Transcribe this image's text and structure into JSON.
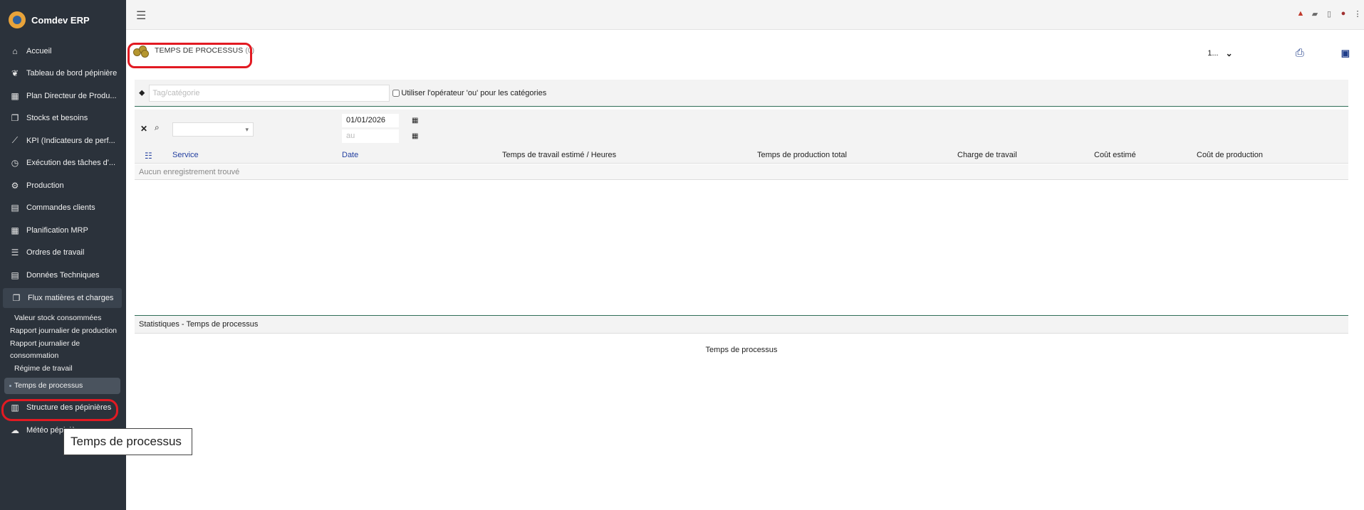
{
  "sidebar": {
    "brand": "Comdev ERP",
    "items": [
      {
        "label": "Accueil",
        "icon": "home-icon"
      },
      {
        "label": "Tableau de bord pépinière",
        "icon": "leaf-icon"
      },
      {
        "label": "Plan Directeur de Produ...",
        "icon": "calendar-icon"
      },
      {
        "label": "Stocks et besoins",
        "icon": "boxes-icon"
      },
      {
        "label": "KPI (Indicateurs de perf...",
        "icon": "chart-line-icon"
      },
      {
        "label": "Exécution des tâches d'...",
        "icon": "clock-icon"
      },
      {
        "label": "Production",
        "icon": "cogs-icon"
      },
      {
        "label": "Commandes clients",
        "icon": "file-icon"
      },
      {
        "label": "Planification MRP",
        "icon": "calendar-icon"
      },
      {
        "label": "Ordres de travail",
        "icon": "tasks-icon"
      },
      {
        "label": "Données Techniques",
        "icon": "file-icon"
      },
      {
        "label": "Flux matières et charges",
        "icon": "boxes-icon"
      }
    ],
    "subitems": [
      "Valeur stock consommées",
      "Rapport journalier de production",
      "Rapport journalier de consommation",
      "Régime de travail",
      "Temps de processus"
    ],
    "after_items": [
      {
        "label": "Structure des pépinières",
        "icon": "grid-icon"
      },
      {
        "label": "Météo pépinière",
        "icon": "weather-icon"
      }
    ]
  },
  "page": {
    "title": "TEMPS DE PROCESSUS",
    "count": "(0)",
    "page_size": "1..."
  },
  "filters": {
    "tag_placeholder": "Tag/catégorie",
    "or_label": "Utiliser l'opérateur 'ou' pour les catégories",
    "date_from": "01/01/2026",
    "date_to_placeholder": "au",
    "service_caret": "▾"
  },
  "table": {
    "columns": [
      "Service",
      "Date",
      "Temps de travail estimé / Heures",
      "Temps de production total",
      "Charge de travail",
      "Coût estimé",
      "Coût de production"
    ],
    "empty": "Aucun enregistrement trouvé"
  },
  "stats": {
    "header": "Statistiques - Temps de processus",
    "caption": "Temps de processus"
  },
  "tooltip": "Temps de processus",
  "colors": {
    "sidebar_bg": "#2b323b",
    "accent_blue": "#2440a0",
    "highlight_red": "#e21a22"
  }
}
